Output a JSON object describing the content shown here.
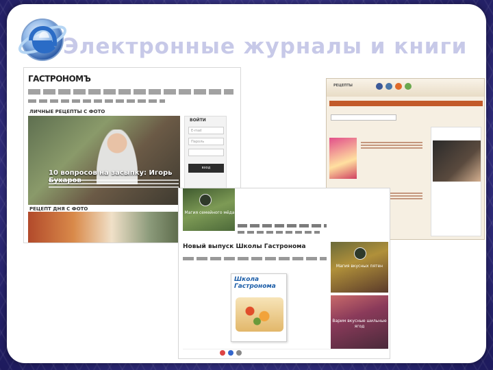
{
  "slide": {
    "title": "Электронные журналы и книги"
  },
  "shot1": {
    "brand": "ГАСТРОНОМЪ",
    "section1": "ЛИЧНЫЕ РЕЦЕПТЫ С ФОТО",
    "hero_title": "10 вопросов на засыпку: Игорь Бухаров",
    "login_title": "ВОЙТИ",
    "login_email": "Е-mail",
    "login_password": "Пароль",
    "login_button": "вход",
    "section2": "РЕЦЕПТ ДНЯ С ФОТО"
  },
  "shot3": {
    "brand": "РЕЦЕПТЫ"
  },
  "shot2": {
    "left_label": "Магия семейного мёда",
    "title": "Новый выпуск Школы Гастронома",
    "cover_title": "Школа Гастронома",
    "right_top_label": "Магия вкусных пятен",
    "right_bot_label": "Варим вкусные шильные ягод"
  },
  "colors": {
    "background": "#3f3b93",
    "title": "#c7c9e8",
    "logo_ring": "#2b6cc6",
    "recipe_accent": "#c25a2a"
  },
  "icons": {
    "logo": "e-globe-icon"
  }
}
